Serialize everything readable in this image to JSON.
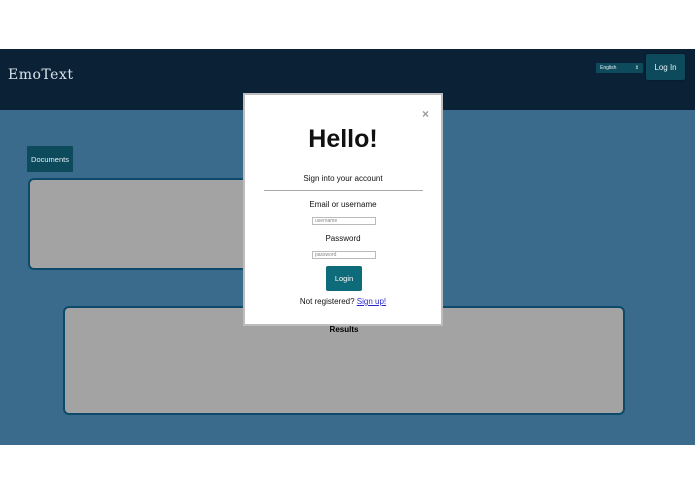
{
  "navbar": {
    "brand": "EmoText",
    "language": "English",
    "login_label": "Log In"
  },
  "main": {
    "documents_label": "Documents",
    "results_title": "Results"
  },
  "modal": {
    "close_glyph": "×",
    "title": "Hello!",
    "subtitle": "Sign into your account",
    "email_label": "Email or username",
    "email_placeholder": "username",
    "password_label": "Password",
    "password_placeholder": "password",
    "login_button": "Login",
    "signup_prompt": "Not registered?",
    "signup_link": "Sign up!"
  },
  "colors": {
    "navbar": "#0b2136",
    "background": "#3a6b8c",
    "accent": "#0e6b7a",
    "panel": "#a3a3a3"
  }
}
